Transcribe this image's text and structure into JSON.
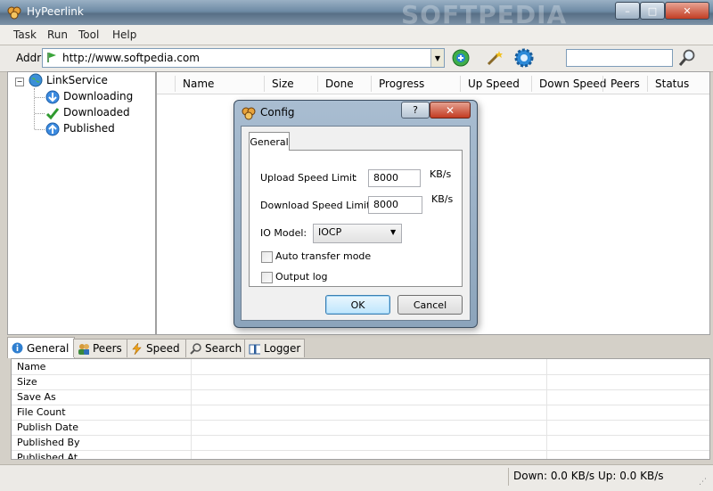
{
  "window": {
    "title": "HyPeerlink",
    "watermark": "SOFTPEDIA",
    "minimize_glyph": "–",
    "maximize_glyph": "□",
    "close_glyph": "✕"
  },
  "menu": [
    "Task",
    "Run",
    "Tool",
    "Help"
  ],
  "address": {
    "label": "Addr:",
    "value": "http://www.softpedia.com",
    "search_placeholder": ""
  },
  "tree": {
    "root": "LinkService",
    "children": [
      "Downloading",
      "Downloaded",
      "Published"
    ]
  },
  "grid": {
    "columns": [
      "Name",
      "Size",
      "Done",
      "Progress",
      "Up Speed",
      "Down Speed",
      "Peers",
      "Status"
    ]
  },
  "bottom_tabs": [
    "General",
    "Peers",
    "Speed",
    "Search",
    "Logger"
  ],
  "properties": {
    "rows": [
      "Name",
      "Size",
      "Save As",
      "File Count",
      "Publish Date",
      "Published By",
      "Published At"
    ]
  },
  "status": {
    "text": "Down: 0.0  KB/s  Up: 0.0  KB/s"
  },
  "dialog": {
    "title": "Config",
    "help_glyph": "?",
    "close_glyph": "✕",
    "tab": "General",
    "upload_label": "Upload Speed Limit",
    "upload_colon": ":",
    "upload_value": "8000",
    "upload_unit": "KB/s",
    "download_label": "Download Speed Limit :",
    "download_value": "8000",
    "download_unit": "KB/s",
    "io_label": "IO Model:",
    "io_value": "IOCP",
    "auto_transfer_label": "Auto transfer mode",
    "auto_transfer_checked": false,
    "output_log_label": "Output log",
    "output_log_checked": false,
    "ok_label": "OK",
    "cancel_label": "Cancel"
  },
  "colors": {
    "titlebar": "#6e8ba5",
    "window_bg": "#d4d0c8",
    "dialog_frame": "#8ca4bb",
    "close_red": "#c23e24"
  }
}
